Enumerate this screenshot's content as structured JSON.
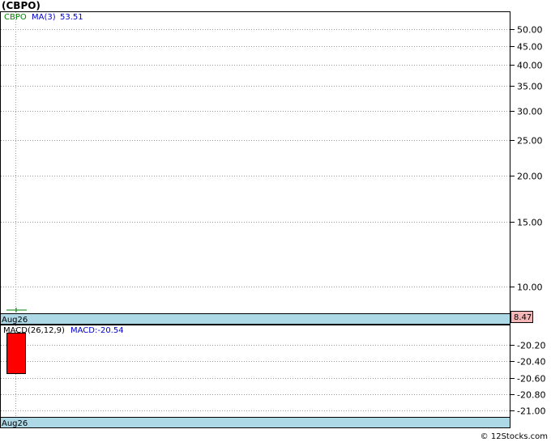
{
  "title": "(CBPO)",
  "watermark": "© 12Stocks.com",
  "chart_data": [
    {
      "type": "line",
      "panel": "price",
      "legend": {
        "symbol": "CBPO",
        "ma_label": "MA(3)",
        "ma_value": "53.51"
      },
      "y_scale": "log",
      "y_ticks": [
        "50.00",
        "45.00",
        "40.00",
        "35.00",
        "30.00",
        "25.00",
        "20.00",
        "15.00",
        "10.00"
      ],
      "y_tick_values": [
        50,
        45,
        40,
        35,
        30,
        25,
        20,
        15,
        10
      ],
      "ylim": [
        8.47,
        55.5
      ],
      "x_label": "Aug26",
      "last_price": "8.47",
      "series": [
        {
          "name": "CBPO",
          "values": [
            8.47
          ]
        }
      ],
      "grid": true
    },
    {
      "type": "bar",
      "panel": "macd",
      "legend": {
        "params": "MACD(26,12,9)",
        "value_label": "MACD:-20.54"
      },
      "y_ticks": [
        "-20.20",
        "-20.40",
        "-20.60",
        "-20.80",
        "-21.00"
      ],
      "y_tick_values": [
        -20.2,
        -20.4,
        -20.6,
        -20.8,
        -21.0
      ],
      "ylim": [
        -21.08,
        -19.96
      ],
      "x_label": "Aug26",
      "bars": [
        {
          "top": -20.05,
          "bottom": -20.54,
          "color": "#ff0000"
        }
      ],
      "grid": true
    }
  ],
  "colors": {
    "symbol_label": "#008000",
    "ma_label": "#0000cc",
    "macd_label": "#0000cc",
    "date_bar": "#add8e6",
    "price_tag": "#f4b6b6",
    "macd_bar": "#ff0000",
    "grid": "#999999",
    "cross": "#008000"
  }
}
